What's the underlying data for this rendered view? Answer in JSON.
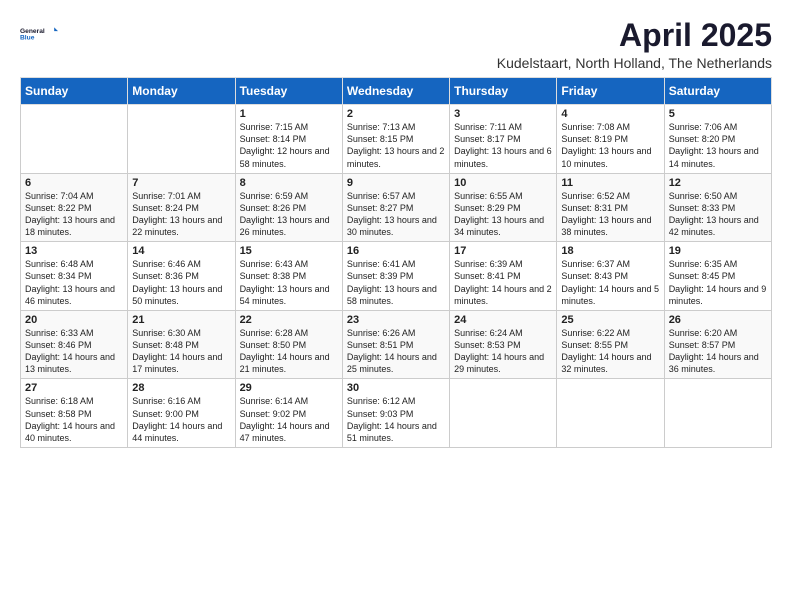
{
  "logo": {
    "general": "General",
    "blue": "Blue"
  },
  "title": "April 2025",
  "location": "Kudelstaart, North Holland, The Netherlands",
  "weekdays": [
    "Sunday",
    "Monday",
    "Tuesday",
    "Wednesday",
    "Thursday",
    "Friday",
    "Saturday"
  ],
  "weeks": [
    [
      {
        "day": "",
        "info": ""
      },
      {
        "day": "",
        "info": ""
      },
      {
        "day": "1",
        "info": "Sunrise: 7:15 AM\nSunset: 8:14 PM\nDaylight: 12 hours and 58 minutes."
      },
      {
        "day": "2",
        "info": "Sunrise: 7:13 AM\nSunset: 8:15 PM\nDaylight: 13 hours and 2 minutes."
      },
      {
        "day": "3",
        "info": "Sunrise: 7:11 AM\nSunset: 8:17 PM\nDaylight: 13 hours and 6 minutes."
      },
      {
        "day": "4",
        "info": "Sunrise: 7:08 AM\nSunset: 8:19 PM\nDaylight: 13 hours and 10 minutes."
      },
      {
        "day": "5",
        "info": "Sunrise: 7:06 AM\nSunset: 8:20 PM\nDaylight: 13 hours and 14 minutes."
      }
    ],
    [
      {
        "day": "6",
        "info": "Sunrise: 7:04 AM\nSunset: 8:22 PM\nDaylight: 13 hours and 18 minutes."
      },
      {
        "day": "7",
        "info": "Sunrise: 7:01 AM\nSunset: 8:24 PM\nDaylight: 13 hours and 22 minutes."
      },
      {
        "day": "8",
        "info": "Sunrise: 6:59 AM\nSunset: 8:26 PM\nDaylight: 13 hours and 26 minutes."
      },
      {
        "day": "9",
        "info": "Sunrise: 6:57 AM\nSunset: 8:27 PM\nDaylight: 13 hours and 30 minutes."
      },
      {
        "day": "10",
        "info": "Sunrise: 6:55 AM\nSunset: 8:29 PM\nDaylight: 13 hours and 34 minutes."
      },
      {
        "day": "11",
        "info": "Sunrise: 6:52 AM\nSunset: 8:31 PM\nDaylight: 13 hours and 38 minutes."
      },
      {
        "day": "12",
        "info": "Sunrise: 6:50 AM\nSunset: 8:33 PM\nDaylight: 13 hours and 42 minutes."
      }
    ],
    [
      {
        "day": "13",
        "info": "Sunrise: 6:48 AM\nSunset: 8:34 PM\nDaylight: 13 hours and 46 minutes."
      },
      {
        "day": "14",
        "info": "Sunrise: 6:46 AM\nSunset: 8:36 PM\nDaylight: 13 hours and 50 minutes."
      },
      {
        "day": "15",
        "info": "Sunrise: 6:43 AM\nSunset: 8:38 PM\nDaylight: 13 hours and 54 minutes."
      },
      {
        "day": "16",
        "info": "Sunrise: 6:41 AM\nSunset: 8:39 PM\nDaylight: 13 hours and 58 minutes."
      },
      {
        "day": "17",
        "info": "Sunrise: 6:39 AM\nSunset: 8:41 PM\nDaylight: 14 hours and 2 minutes."
      },
      {
        "day": "18",
        "info": "Sunrise: 6:37 AM\nSunset: 8:43 PM\nDaylight: 14 hours and 5 minutes."
      },
      {
        "day": "19",
        "info": "Sunrise: 6:35 AM\nSunset: 8:45 PM\nDaylight: 14 hours and 9 minutes."
      }
    ],
    [
      {
        "day": "20",
        "info": "Sunrise: 6:33 AM\nSunset: 8:46 PM\nDaylight: 14 hours and 13 minutes."
      },
      {
        "day": "21",
        "info": "Sunrise: 6:30 AM\nSunset: 8:48 PM\nDaylight: 14 hours and 17 minutes."
      },
      {
        "day": "22",
        "info": "Sunrise: 6:28 AM\nSunset: 8:50 PM\nDaylight: 14 hours and 21 minutes."
      },
      {
        "day": "23",
        "info": "Sunrise: 6:26 AM\nSunset: 8:51 PM\nDaylight: 14 hours and 25 minutes."
      },
      {
        "day": "24",
        "info": "Sunrise: 6:24 AM\nSunset: 8:53 PM\nDaylight: 14 hours and 29 minutes."
      },
      {
        "day": "25",
        "info": "Sunrise: 6:22 AM\nSunset: 8:55 PM\nDaylight: 14 hours and 32 minutes."
      },
      {
        "day": "26",
        "info": "Sunrise: 6:20 AM\nSunset: 8:57 PM\nDaylight: 14 hours and 36 minutes."
      }
    ],
    [
      {
        "day": "27",
        "info": "Sunrise: 6:18 AM\nSunset: 8:58 PM\nDaylight: 14 hours and 40 minutes."
      },
      {
        "day": "28",
        "info": "Sunrise: 6:16 AM\nSunset: 9:00 PM\nDaylight: 14 hours and 44 minutes."
      },
      {
        "day": "29",
        "info": "Sunrise: 6:14 AM\nSunset: 9:02 PM\nDaylight: 14 hours and 47 minutes."
      },
      {
        "day": "30",
        "info": "Sunrise: 6:12 AM\nSunset: 9:03 PM\nDaylight: 14 hours and 51 minutes."
      },
      {
        "day": "",
        "info": ""
      },
      {
        "day": "",
        "info": ""
      },
      {
        "day": "",
        "info": ""
      }
    ]
  ]
}
